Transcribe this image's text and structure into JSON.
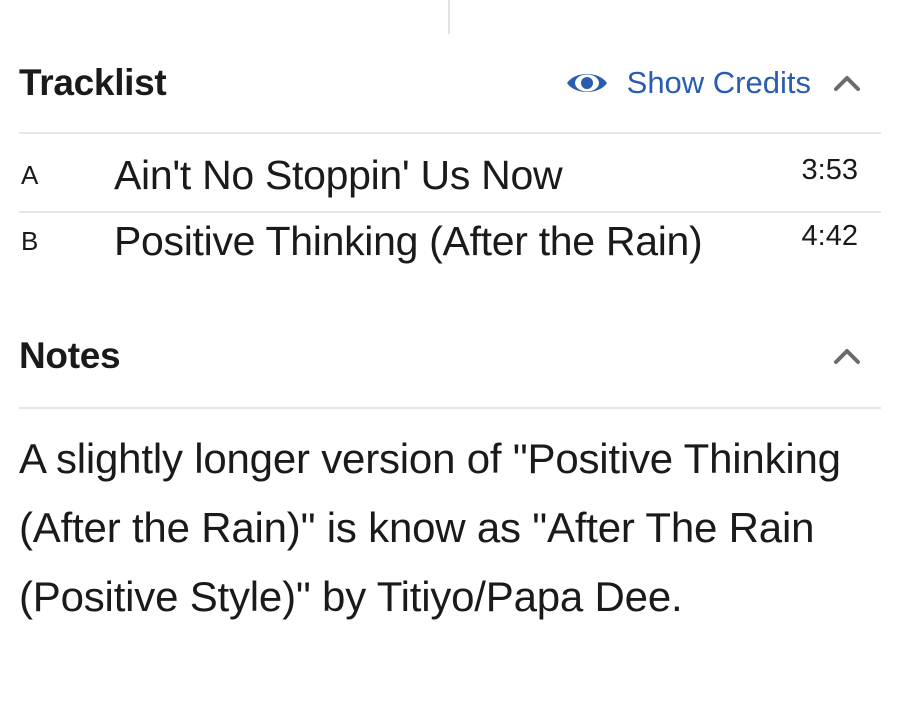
{
  "tracklist": {
    "title": "Tracklist",
    "show_credits_label": "Show Credits",
    "tracks": [
      {
        "position": "A",
        "title": "Ain't No Stoppin' Us Now",
        "duration": "3:53"
      },
      {
        "position": "B",
        "title": "Positive Thinking (After the Rain)",
        "duration": "4:42"
      }
    ]
  },
  "notes": {
    "title": "Notes",
    "text": "A slightly longer version of \"Positive Thinking (After the Rain)\" is know as \"After The Rain (Positive Style)\" by Titiyo/Papa Dee."
  },
  "colors": {
    "accent": "#2a5db0",
    "text": "#1a1a1a",
    "divider": "#e6e6e6",
    "chevron": "#6b6b6b"
  },
  "icons": {
    "credits": "eye-icon",
    "collapse": "chevron-up-icon"
  }
}
